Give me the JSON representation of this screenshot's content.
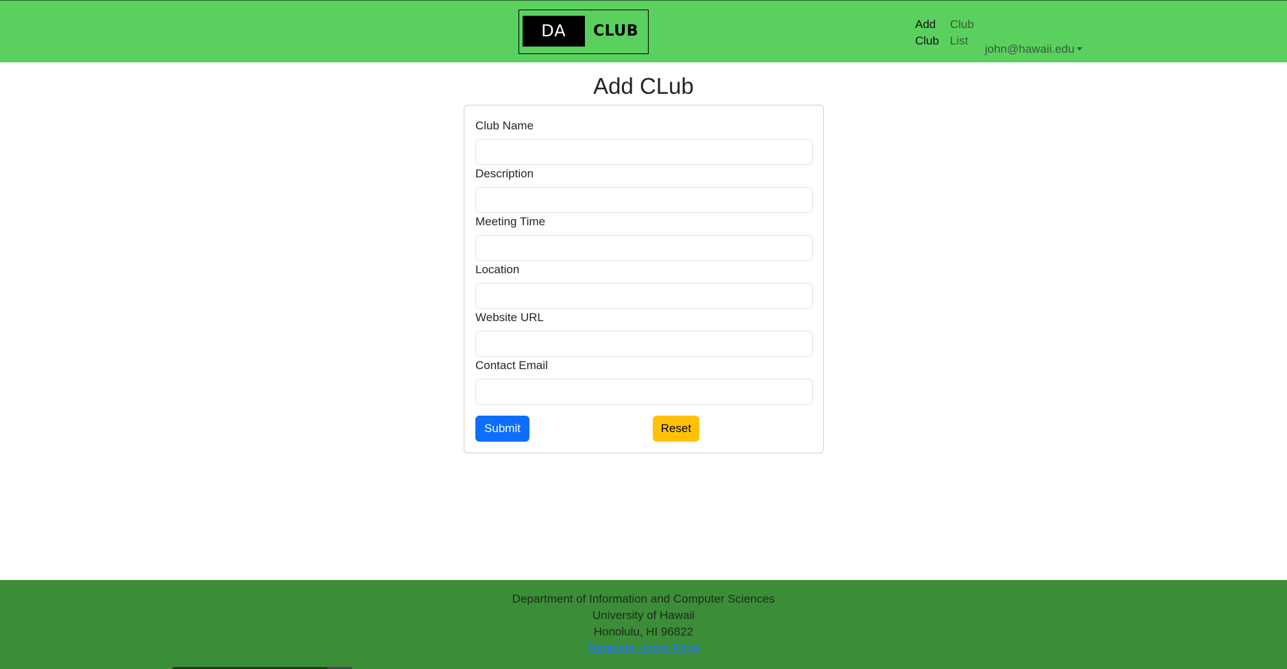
{
  "navbar": {
    "logo": {
      "left_text": "DA",
      "right_text": "CLUB"
    },
    "links": [
      {
        "label": "Add\nClub",
        "active": true
      },
      {
        "label": "Club\nList",
        "active": false
      }
    ],
    "user": {
      "email": "john@hawaii.edu"
    }
  },
  "main": {
    "title": "Add CLub",
    "form": {
      "fields": [
        {
          "label": "Club Name",
          "value": ""
        },
        {
          "label": "Description",
          "value": ""
        },
        {
          "label": "Meeting Time",
          "value": ""
        },
        {
          "label": "Location",
          "value": ""
        },
        {
          "label": "Website URL",
          "value": ""
        },
        {
          "label": "Contact Email",
          "value": ""
        }
      ],
      "submit_label": "Submit",
      "reset_label": "Reset"
    }
  },
  "footer": {
    "lines": [
      "Department of Information and Computer Sciences",
      "University of Hawaii",
      "Honolulu, HI 96822"
    ],
    "link_text": "Template Home Page"
  },
  "colors": {
    "navbar_bg": "#5ad15f",
    "footer_bg": "#3c8d37",
    "submit_bg": "#0d6efd",
    "reset_bg": "#ffc107"
  }
}
